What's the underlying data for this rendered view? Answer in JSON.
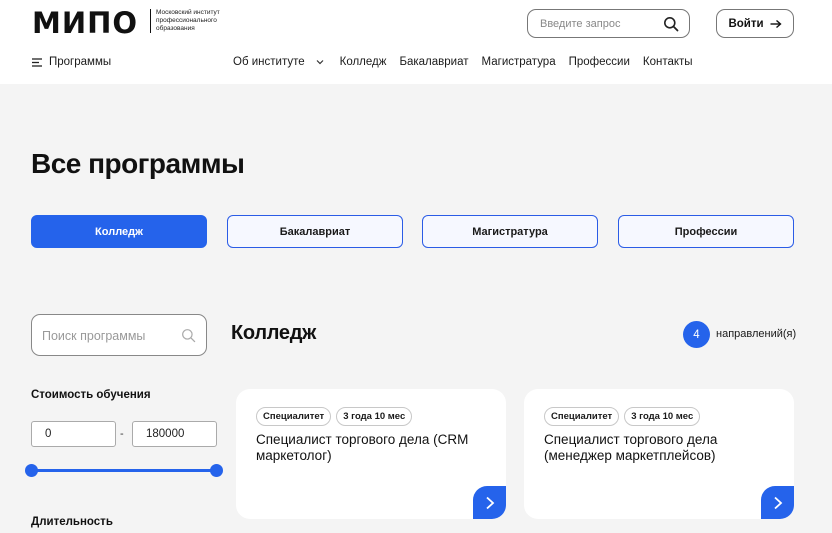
{
  "header": {
    "logo": "МИПО",
    "logo_subtitle": "Московский институт профессионального образования",
    "search_placeholder": "Введите запрос",
    "login_label": "Войти"
  },
  "nav": {
    "programs_label": "Программы",
    "links": [
      "Об институте",
      "Колледж",
      "Бакалавриат",
      "Магистратура",
      "Профессии",
      "Контакты"
    ]
  },
  "main": {
    "title": "Все программы",
    "tabs": [
      {
        "label": "Колледж",
        "active": true
      },
      {
        "label": "Бакалавриат",
        "active": false
      },
      {
        "label": "Магистратура",
        "active": false
      },
      {
        "label": "Профессии",
        "active": false
      }
    ],
    "search_placeholder": "Поиск программы",
    "section_title": "Колледж",
    "count": "4",
    "count_label": "направлений(я)"
  },
  "filters": {
    "cost_title": "Стоимость обучения",
    "price_min": "0",
    "price_max": "180000",
    "price_dash": "-",
    "duration_title": "Длительность"
  },
  "cards": [
    {
      "tags": [
        "Специалитет",
        "3 года 10 мес"
      ],
      "title": "Специалист торгового дела (CRM маркетолог)"
    },
    {
      "tags": [
        "Специалитет",
        "3 года 10 мес"
      ],
      "title": "Специалист торгового дела (менеджер маркетплейсов)"
    }
  ],
  "colors": {
    "accent": "#2563eb"
  },
  "icons": {
    "search": "search-icon",
    "login_arrow": "arrow-right-icon",
    "menu": "menu-icon",
    "dropdown": "chevron-down-icon",
    "card_arrow": "chevron-right-icon"
  }
}
